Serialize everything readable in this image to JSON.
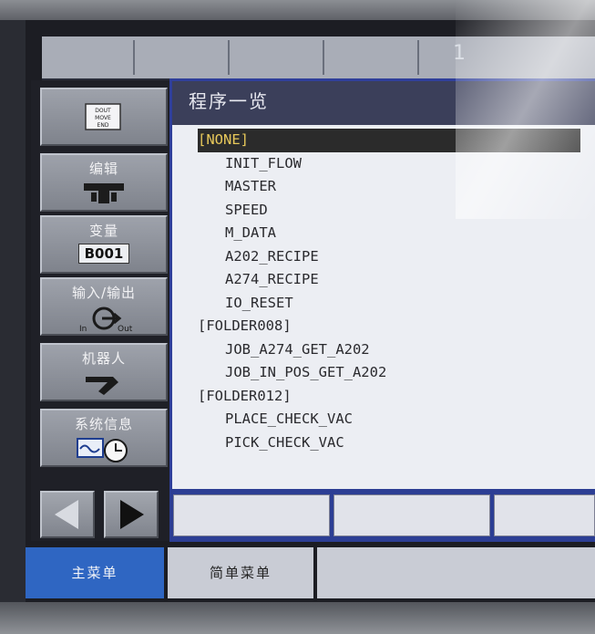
{
  "header": {
    "title": "1"
  },
  "panel": {
    "title": "程序一览"
  },
  "program_list": [
    {
      "text": "[NONE]",
      "kind": "sel"
    },
    {
      "text": "INIT_FLOW",
      "kind": "item"
    },
    {
      "text": "MASTER",
      "kind": "item"
    },
    {
      "text": "SPEED",
      "kind": "item"
    },
    {
      "text": "M_DATA",
      "kind": "item"
    },
    {
      "text": "A202_RECIPE",
      "kind": "item"
    },
    {
      "text": "A274_RECIPE",
      "kind": "item"
    },
    {
      "text": "IO_RESET",
      "kind": "item"
    },
    {
      "text": "[FOLDER008]",
      "kind": "folder"
    },
    {
      "text": "JOB_A274_GET_A202",
      "kind": "item"
    },
    {
      "text": "JOB_IN_POS_GET_A202",
      "kind": "item"
    },
    {
      "text": "[FOLDER012]",
      "kind": "folder"
    },
    {
      "text": "PLACE_CHECK_VAC",
      "kind": "item"
    },
    {
      "text": "PICK_CHECK_VAC",
      "kind": "item"
    }
  ],
  "sidebar": {
    "items": [
      {
        "label": "",
        "badge": "DOUT MOVE END",
        "icon": "dout-move-end-icon"
      },
      {
        "label": "编辑",
        "icon": "edit-icon"
      },
      {
        "label": "变量",
        "value": "B001",
        "icon": "variable-icon"
      },
      {
        "label": "输入/输出",
        "icon": "io-icon"
      },
      {
        "label": "机器人",
        "icon": "robot-icon"
      },
      {
        "label": "系统信息",
        "icon": "system-info-icon"
      }
    ]
  },
  "bottom_tabs": {
    "main": "主菜单",
    "simple": "简单菜单"
  },
  "colors": {
    "accent_blue": "#2f66c2",
    "selection_bg": "#2b2b2b",
    "selection_text": "#e7c85a",
    "panel_bg": "#eceef3"
  }
}
